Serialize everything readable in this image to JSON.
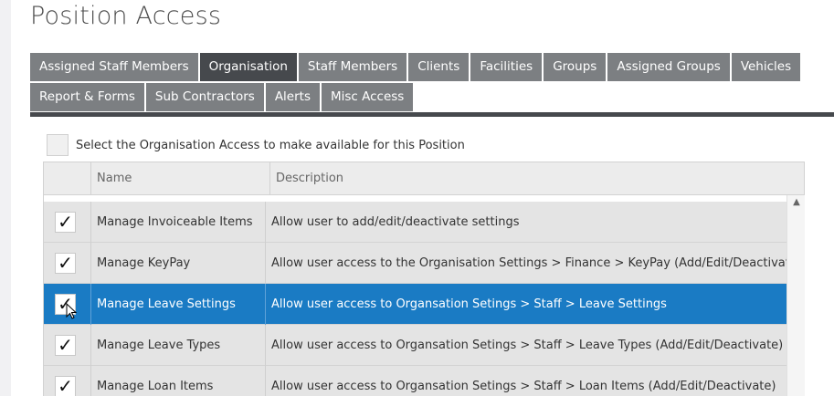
{
  "page": {
    "title": "Position Access"
  },
  "tabs": {
    "row1": [
      {
        "label": "Assigned Staff Members",
        "active": false
      },
      {
        "label": "Organisation",
        "active": true
      },
      {
        "label": "Staff Members",
        "active": false
      },
      {
        "label": "Clients",
        "active": false
      },
      {
        "label": "Facilities",
        "active": false
      },
      {
        "label": "Groups",
        "active": false
      },
      {
        "label": "Assigned Groups",
        "active": false
      },
      {
        "label": "Vehicles",
        "active": false
      }
    ],
    "row2": [
      {
        "label": "Report & Forms",
        "active": false
      },
      {
        "label": "Sub Contractors",
        "active": false
      },
      {
        "label": "Alerts",
        "active": false
      },
      {
        "label": "Misc Access",
        "active": false
      }
    ]
  },
  "select_all": {
    "label": "Select the Organisation Access to make available for this Position",
    "checked": false
  },
  "grid": {
    "columns": {
      "name": "Name",
      "description": "Description"
    },
    "rows": [
      {
        "checked": true,
        "name": "Manage Invoiceable Items",
        "description": "Allow user to add/edit/deactivate settings",
        "selected": false
      },
      {
        "checked": true,
        "name": "Manage KeyPay",
        "description": "Allow user access to the Organisation Settings > Finance > KeyPay (Add/Edit/Deactivate)",
        "selected": false
      },
      {
        "checked": true,
        "name": "Manage Leave Settings",
        "description": "Allow user access to Organsation Setings > Staff > Leave Settings",
        "selected": true
      },
      {
        "checked": true,
        "name": "Manage Leave Types",
        "description": "Allow user access to Organsation Setings > Staff > Leave Types (Add/Edit/Deactivate)",
        "selected": false
      },
      {
        "checked": true,
        "name": "Manage Loan Items",
        "description": "Allow user access to Organsation Setings > Staff > Loan Items (Add/Edit/Deactivate)",
        "selected": false
      }
    ]
  },
  "icons": {
    "check": "check-icon",
    "scroll_up": "chevron-up-icon",
    "cursor": "mouse-pointer-icon"
  },
  "colors": {
    "tab_inactive": "#7c7f82",
    "tab_active": "#46494d",
    "row_selected": "#1a7bc4",
    "row_bg": "#e4e4e4"
  }
}
